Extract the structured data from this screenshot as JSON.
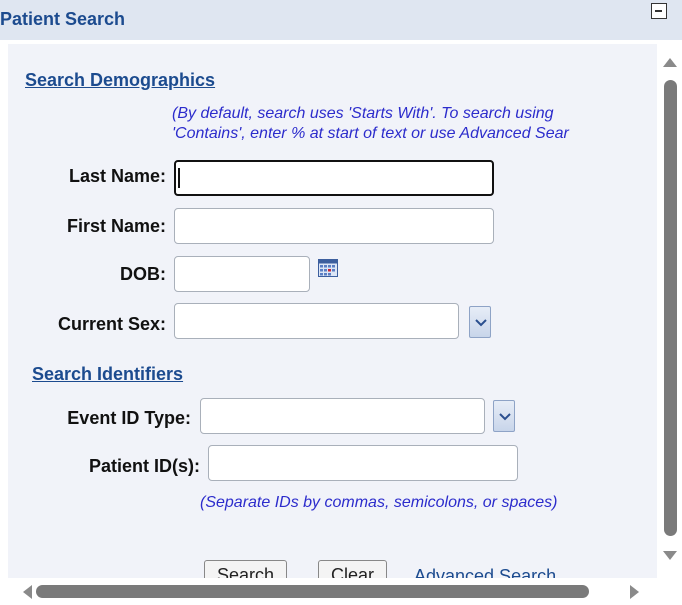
{
  "panel": {
    "title": "Patient Search"
  },
  "demographics": {
    "heading": "Search Demographics",
    "hint_line1": "(By default, search uses 'Starts With'. To search using",
    "hint_line2": "'Contains', enter % at start of text or use Advanced Sear",
    "last_name_label": "Last Name:",
    "last_name_value": "",
    "first_name_label": "First Name:",
    "first_name_value": "",
    "dob_label": "DOB:",
    "dob_value": "",
    "current_sex_label": "Current Sex:",
    "current_sex_value": ""
  },
  "identifiers": {
    "heading": "Search Identifiers",
    "event_id_type_label": "Event ID Type:",
    "event_id_type_value": "",
    "patient_ids_label": "Patient ID(s):",
    "patient_ids_value": "",
    "patient_ids_hint": "(Separate IDs by commas, semicolons, or spaces)"
  },
  "actions": {
    "search_label": "Search",
    "clear_label": "Clear",
    "advanced_search_label": "Advanced Search"
  },
  "icons": {
    "collapse": "collapse-icon",
    "calendar": "calendar-icon",
    "dropdown": "chevron-down-icon"
  },
  "colors": {
    "header_bg": "#dfe6f1",
    "heading_text": "#1c4b8f",
    "hint_text": "#2c2ccc",
    "content_bg": "#f1f3f9"
  }
}
